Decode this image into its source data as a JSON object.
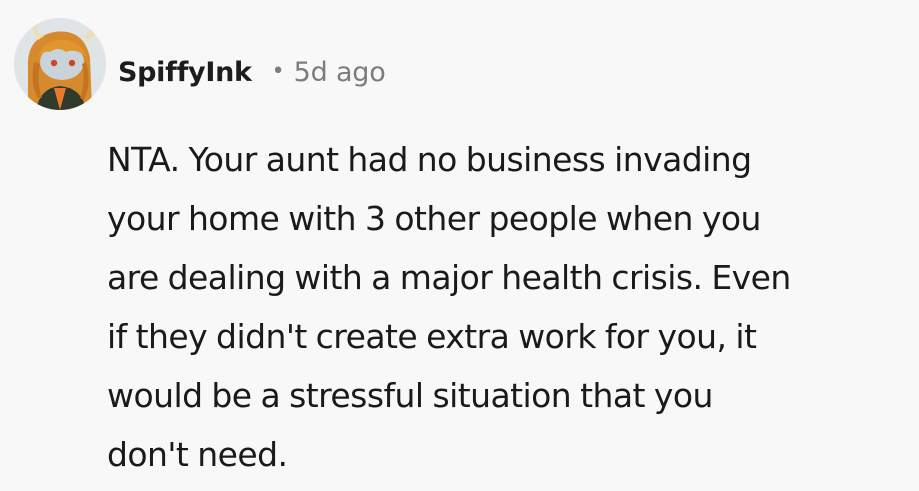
{
  "comment": {
    "author": "SpiffyInk",
    "separator": "•",
    "timestamp": "5d ago",
    "avatar_icon": "user-avatar-icon",
    "body_lines": [
      "NTA. Your aunt had no business invading",
      "your home with 3 other people when you",
      "are dealing with a major health crisis. Even",
      "if they didn't create extra work for you, it",
      "would be a stressful situation that you",
      "don't need."
    ]
  },
  "colors": {
    "background": "#f8f8f8",
    "text": "#1a1a1b",
    "meta": "#7c7c7c"
  }
}
